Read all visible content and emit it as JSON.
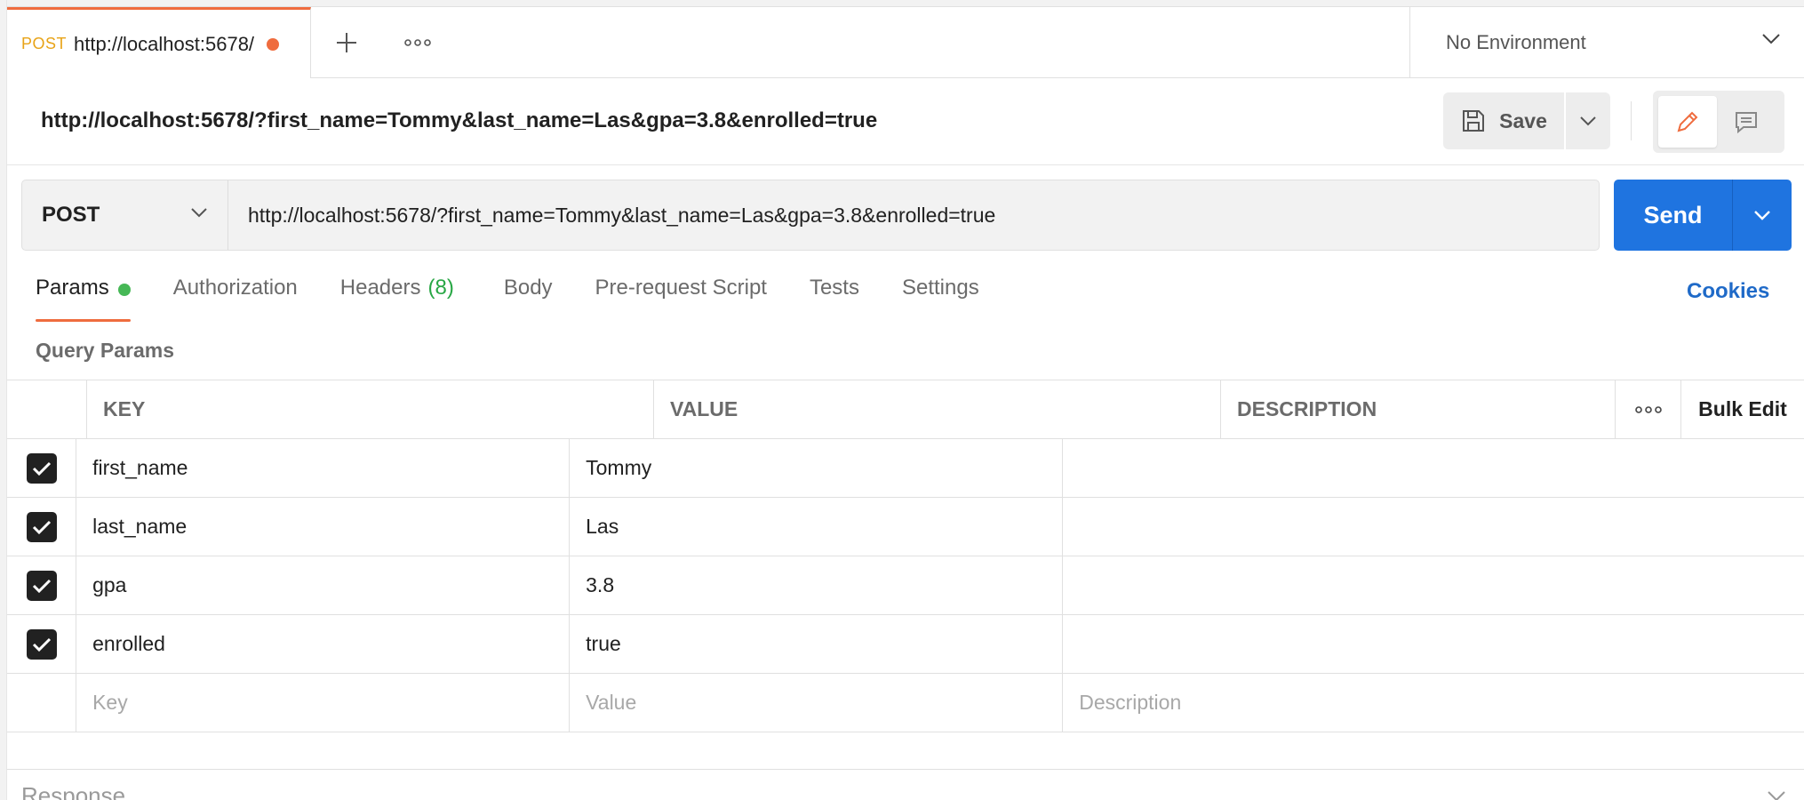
{
  "tab": {
    "method": "POST",
    "url": "http://localhost:5678/"
  },
  "environment": {
    "label": "No Environment"
  },
  "request": {
    "title": "http://localhost:5678/?first_name=Tommy&last_name=Las&gpa=3.8&enrolled=true",
    "method": "POST",
    "url": "http://localhost:5678/?first_name=Tommy&last_name=Las&gpa=3.8&enrolled=true"
  },
  "toolbar": {
    "save_label": "Save",
    "send_label": "Send"
  },
  "request_tabs": [
    {
      "label": "Params",
      "active": true
    },
    {
      "label": "Authorization"
    },
    {
      "label": "Headers",
      "count": "(8)"
    },
    {
      "label": "Body"
    },
    {
      "label": "Pre-request Script"
    },
    {
      "label": "Tests"
    },
    {
      "label": "Settings"
    }
  ],
  "cookies_label": "Cookies",
  "query_params": {
    "label": "Query Params",
    "headers": {
      "key": "KEY",
      "value": "VALUE",
      "description": "DESCRIPTION",
      "bulk_edit": "Bulk Edit"
    },
    "rows": [
      {
        "key": "first_name",
        "value": "Tommy",
        "checked": true
      },
      {
        "key": "last_name",
        "value": "Las",
        "checked": true
      },
      {
        "key": "gpa",
        "value": "3.8",
        "checked": true
      },
      {
        "key": "enrolled",
        "value": "true",
        "checked": true
      }
    ],
    "placeholders": {
      "key": "Key",
      "value": "Value",
      "description": "Description"
    }
  },
  "response_label": "Response",
  "colors": {
    "accent": "#ef6c3e",
    "send": "#1f74e0",
    "params_dot": "#46b856",
    "headers_count": "#28a745",
    "cookies": "#1f6ac8"
  }
}
